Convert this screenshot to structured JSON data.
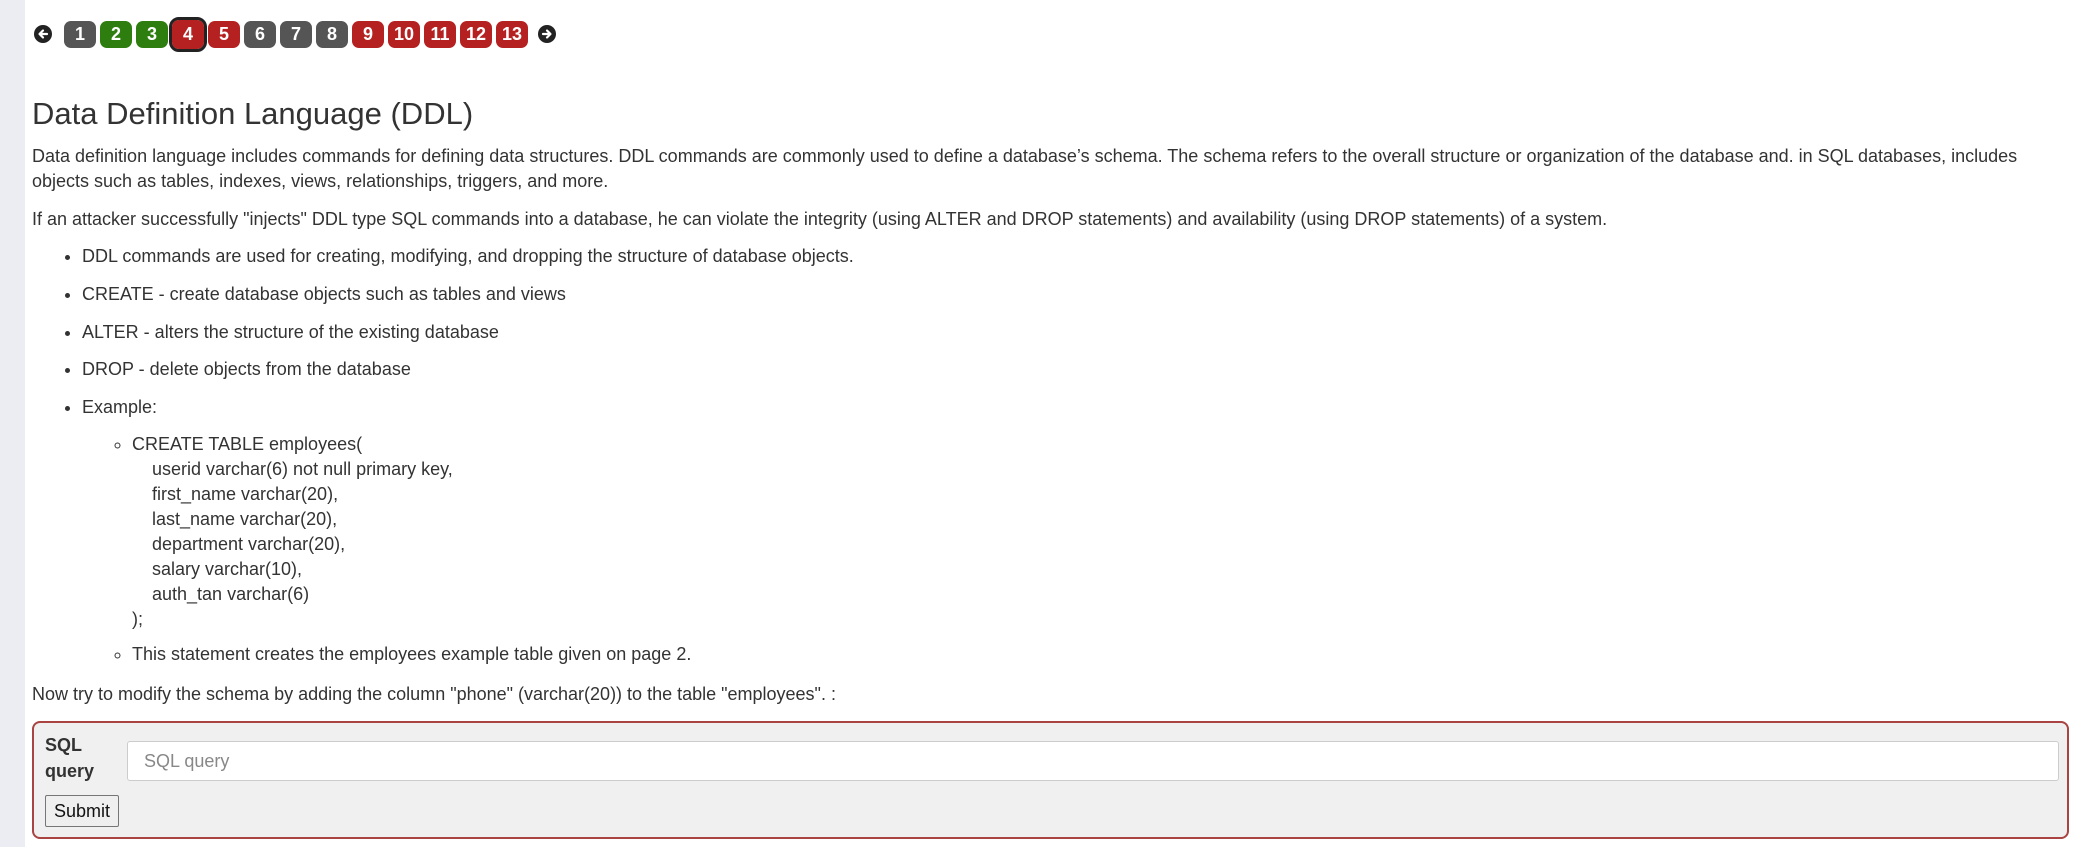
{
  "pager": {
    "prev_icon": "arrow-left-circle-icon",
    "next_icon": "arrow-right-circle-icon",
    "pages": [
      {
        "label": "1",
        "status": "gray"
      },
      {
        "label": "2",
        "status": "green"
      },
      {
        "label": "3",
        "status": "green"
      },
      {
        "label": "4",
        "status": "current"
      },
      {
        "label": "5",
        "status": "red"
      },
      {
        "label": "6",
        "status": "gray"
      },
      {
        "label": "7",
        "status": "gray"
      },
      {
        "label": "8",
        "status": "gray"
      },
      {
        "label": "9",
        "status": "red"
      },
      {
        "label": "10",
        "status": "red"
      },
      {
        "label": "11",
        "status": "red"
      },
      {
        "label": "12",
        "status": "red"
      },
      {
        "label": "13",
        "status": "red"
      }
    ],
    "colors": {
      "gray": "#555555",
      "green": "#2e7d0f",
      "red": "#b52121"
    }
  },
  "lesson": {
    "title": "Data Definition Language (DDL)",
    "intro": "Data definition language includes commands for defining data structures. DDL commands are commonly used to define a database’s schema. The schema refers to the overall structure or organization of the database and. in SQL databases, includes objects such as tables, indexes, views, relationships, triggers, and more.",
    "attack_note": "If an attacker successfully \"injects\" DDL type SQL commands into a database, he can violate the integrity (using ALTER and DROP statements) and availability (using DROP statements) of a system.",
    "bullets": [
      "DDL commands are used for creating, modifying, and dropping the structure of database objects.",
      "CREATE - create database objects such as tables and views",
      "ALTER - alters the structure of the existing database",
      "DROP - delete objects from the database",
      "Example:"
    ],
    "example_code": [
      "CREATE TABLE employees(",
      "userid varchar(6) not null primary key,",
      "first_name varchar(20),",
      "last_name varchar(20),",
      "department varchar(20),",
      "salary varchar(10),",
      "auth_tan varchar(6)",
      ");"
    ],
    "example_note": "This statement creates the employees example table given on page 2.",
    "task": "Now try to modify the schema by adding the column \"phone\" (varchar(20)) to the table \"employees\". :"
  },
  "form": {
    "label": "SQL query",
    "input_placeholder": "SQL query",
    "input_value": "",
    "submit_label": "Submit",
    "border_color": "#a94442"
  }
}
